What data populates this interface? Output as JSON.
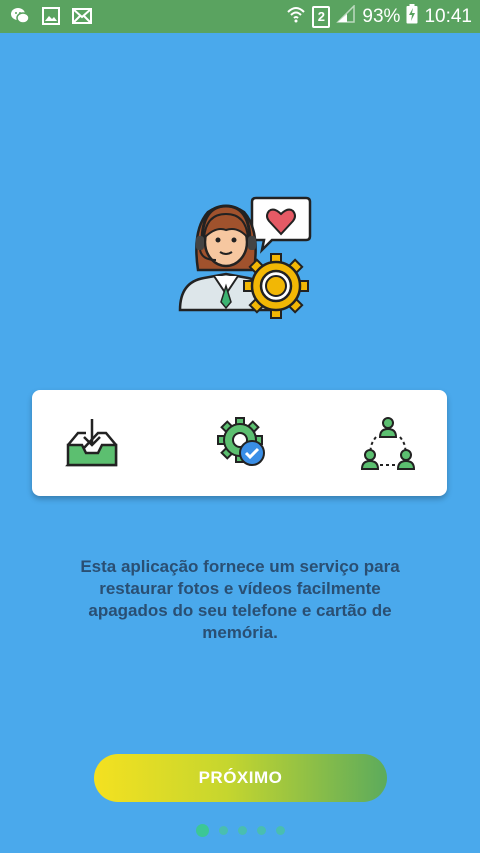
{
  "status_bar": {
    "battery": "93%",
    "time": "10:41",
    "sim_slot": "2",
    "icons": [
      "wechat-icon",
      "image-icon",
      "mail-icon",
      "wifi-icon",
      "sim-icon",
      "signal-icon",
      "battery-charging-icon"
    ]
  },
  "hero": {
    "icon": "customer-support-agent-icon"
  },
  "features": [
    {
      "icon": "download-inbox-icon"
    },
    {
      "icon": "gear-check-icon"
    },
    {
      "icon": "network-people-icon"
    }
  ],
  "description": "Esta aplicação fornece um serviço para restaurar fotos e vídeos facilmente apagados do seu telefone e cartão de memória.",
  "next_button": {
    "label": "PRÓXIMO"
  },
  "pager": {
    "current_page": 1,
    "total_pages": 5
  },
  "colors": {
    "background": "#4aa9ec",
    "status_bar": "#5aa360",
    "text": "#2a4f73",
    "button_start": "#f4e120",
    "button_end": "#5cab5c",
    "dot": "#3cc796"
  }
}
